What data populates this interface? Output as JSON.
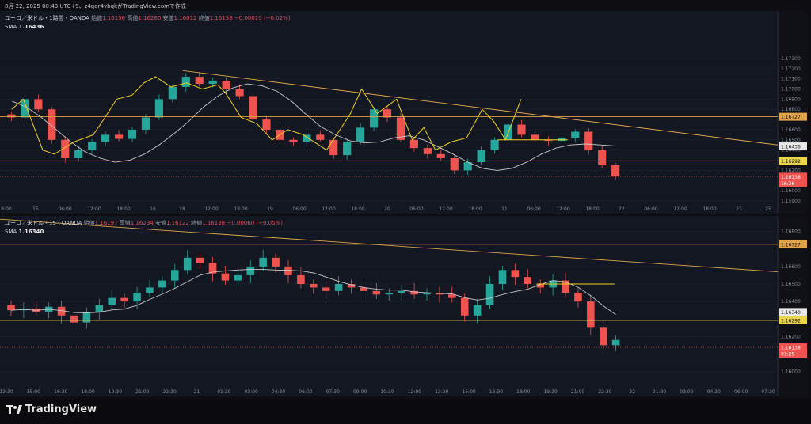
{
  "caption": "8月 22, 2025 00:43 UTC+9、z4gqr4vbqkがTradingView.comで作成",
  "brand": {
    "name": "TradingView"
  },
  "colors": {
    "bg": "#131722",
    "bull": "#26a69a",
    "bear": "#ef5350",
    "sma": "#c8c8c8",
    "trend": "#e0a34a",
    "hline": "#e8d44d",
    "zigzag": "#f0d020",
    "last": "#ef5350"
  },
  "chart_data": [
    {
      "type": "candlestick",
      "title": "ユーロ／米ドル・1時間・OANDA",
      "legend_ohlc": {
        "o_label": "始値",
        "o": "1.16156",
        "h_label": "高値",
        "h": "1.16260",
        "l_label": "安値",
        "l": "1.16012",
        "c_label": "終値",
        "c": "1.16138",
        "chg": "−0.00019 (−0.02%)"
      },
      "sma": {
        "label": "SMA",
        "value": "1.16436"
      },
      "ylim": [
        1.159,
        1.1775
      ],
      "y_ticks": [
        "1.17300",
        "1.17200",
        "1.17100",
        "1.17000",
        "1.16900",
        "1.16800",
        "1.16600",
        "1.16500",
        "1.16400",
        "1.16300",
        "1.16200",
        "1.16000",
        "1.15900"
      ],
      "x_ticks": [
        "8:00",
        "15",
        "06:00",
        "12:00",
        "18:00",
        "16",
        "18",
        "12:00",
        "18:00",
        "19",
        "06:00",
        "12:00",
        "18:00",
        "20",
        "06:00",
        "12:00",
        "18:00",
        "21",
        "06:00",
        "12:00",
        "18:00",
        "22",
        "06:00",
        "12:00",
        "18:00",
        "23",
        "25"
      ],
      "hlines": [
        {
          "price": 1.16727,
          "label": "1.16727",
          "color": "#e0a34a"
        },
        {
          "price": 1.16292,
          "label": "1.16292",
          "color": "#e8d44d"
        }
      ],
      "price_tags": [
        {
          "price": 1.16436,
          "label": "1.16436",
          "kind": "sma"
        },
        {
          "price": 1.16138,
          "label": "1.16138",
          "sub": "16:26",
          "kind": "last"
        }
      ],
      "trendline": {
        "from": [
          0.25,
          1.1718
        ],
        "to": [
          1.0,
          1.1645
        ]
      },
      "series": [
        {
          "name": "SMA",
          "values": [
            1.1688,
            1.1682,
            1.1672,
            1.166,
            1.1648,
            1.1638,
            1.1632,
            1.1628,
            1.163,
            1.1636,
            1.1645,
            1.1656,
            1.1668,
            1.1682,
            1.1693,
            1.1701,
            1.1705,
            1.1703,
            1.1698,
            1.1688,
            1.1675,
            1.1663,
            1.1655,
            1.1649,
            1.1647,
            1.1648,
            1.1652,
            1.1654,
            1.165,
            1.1643,
            1.1636,
            1.1628,
            1.1622,
            1.162,
            1.1622,
            1.1628,
            1.1636,
            1.1642,
            1.1645,
            1.1646,
            1.1645,
            1.1644
          ]
        }
      ],
      "closes": [
        1.1672,
        1.169,
        1.168,
        1.165,
        1.1632,
        1.164,
        1.1648,
        1.1655,
        1.1651,
        1.166,
        1.1672,
        1.169,
        1.1702,
        1.1712,
        1.1705,
        1.1708,
        1.17,
        1.1693,
        1.167,
        1.166,
        1.165,
        1.1648,
        1.1655,
        1.165,
        1.1635,
        1.1648,
        1.1662,
        1.168,
        1.1672,
        1.165,
        1.1642,
        1.1636,
        1.1632,
        1.162,
        1.1628,
        1.164,
        1.165,
        1.1665,
        1.1655,
        1.165,
        1.1649,
        1.1652,
        1.1658,
        1.164,
        1.1625,
        1.1614
      ]
    },
    {
      "type": "candlestick",
      "title": "ユーロ／米ドル・15・OANDA",
      "legend_ohlc": {
        "o_label": "始値",
        "o": "1.16197",
        "h_label": "高値",
        "h": "1.16234",
        "l_label": "安値",
        "l": "1.16122",
        "c_label": "終値",
        "c": "1.16138",
        "chg": "−0.00060 (−0.05%)"
      },
      "sma": {
        "label": "SMA",
        "value": "1.16340"
      },
      "ylim": [
        1.1593,
        1.1688
      ],
      "y_ticks": [
        "1.16800",
        "1.16600",
        "1.16500",
        "1.16400",
        "1.16200",
        "1.16000"
      ],
      "x_ticks": [
        "13:30",
        "15:00",
        "16:30",
        "18:00",
        "19:30",
        "21:00",
        "22:30",
        "21",
        "01:30",
        "03:00",
        "04:30",
        "06:00",
        "07:30",
        "09:00",
        "10:30",
        "12:00",
        "13:30",
        "15:00",
        "16:30",
        "18:00",
        "19:30",
        "21:00",
        "22:30",
        "22",
        "01:30",
        "03:00",
        "04:30",
        "06:00",
        "07:30"
      ],
      "hlines": [
        {
          "price": 1.16727,
          "label": "1.16727",
          "color": "#e0a34a"
        },
        {
          "price": 1.16292,
          "label": "1.16292",
          "color": "#e8d44d"
        }
      ],
      "price_tags": [
        {
          "price": 1.1634,
          "label": "1.16340",
          "kind": "sma"
        },
        {
          "price": 1.16138,
          "label": "1.16138",
          "sub": "01:25",
          "kind": "last"
        }
      ],
      "closes": [
        1.1635,
        1.1636,
        1.1634,
        1.1637,
        1.1632,
        1.1628,
        1.1634,
        1.1638,
        1.1642,
        1.164,
        1.1645,
        1.1648,
        1.1652,
        1.1658,
        1.1665,
        1.1662,
        1.1656,
        1.1652,
        1.1655,
        1.166,
        1.1665,
        1.166,
        1.1655,
        1.165,
        1.1648,
        1.1646,
        1.165,
        1.1648,
        1.1646,
        1.1644,
        1.1645,
        1.1646,
        1.1644,
        1.1645,
        1.1644,
        1.1642,
        1.1632,
        1.1638,
        1.165,
        1.1658,
        1.1654,
        1.165,
        1.1648,
        1.1652,
        1.1645,
        1.164,
        1.1625,
        1.1615,
        1.1618
      ]
    }
  ]
}
